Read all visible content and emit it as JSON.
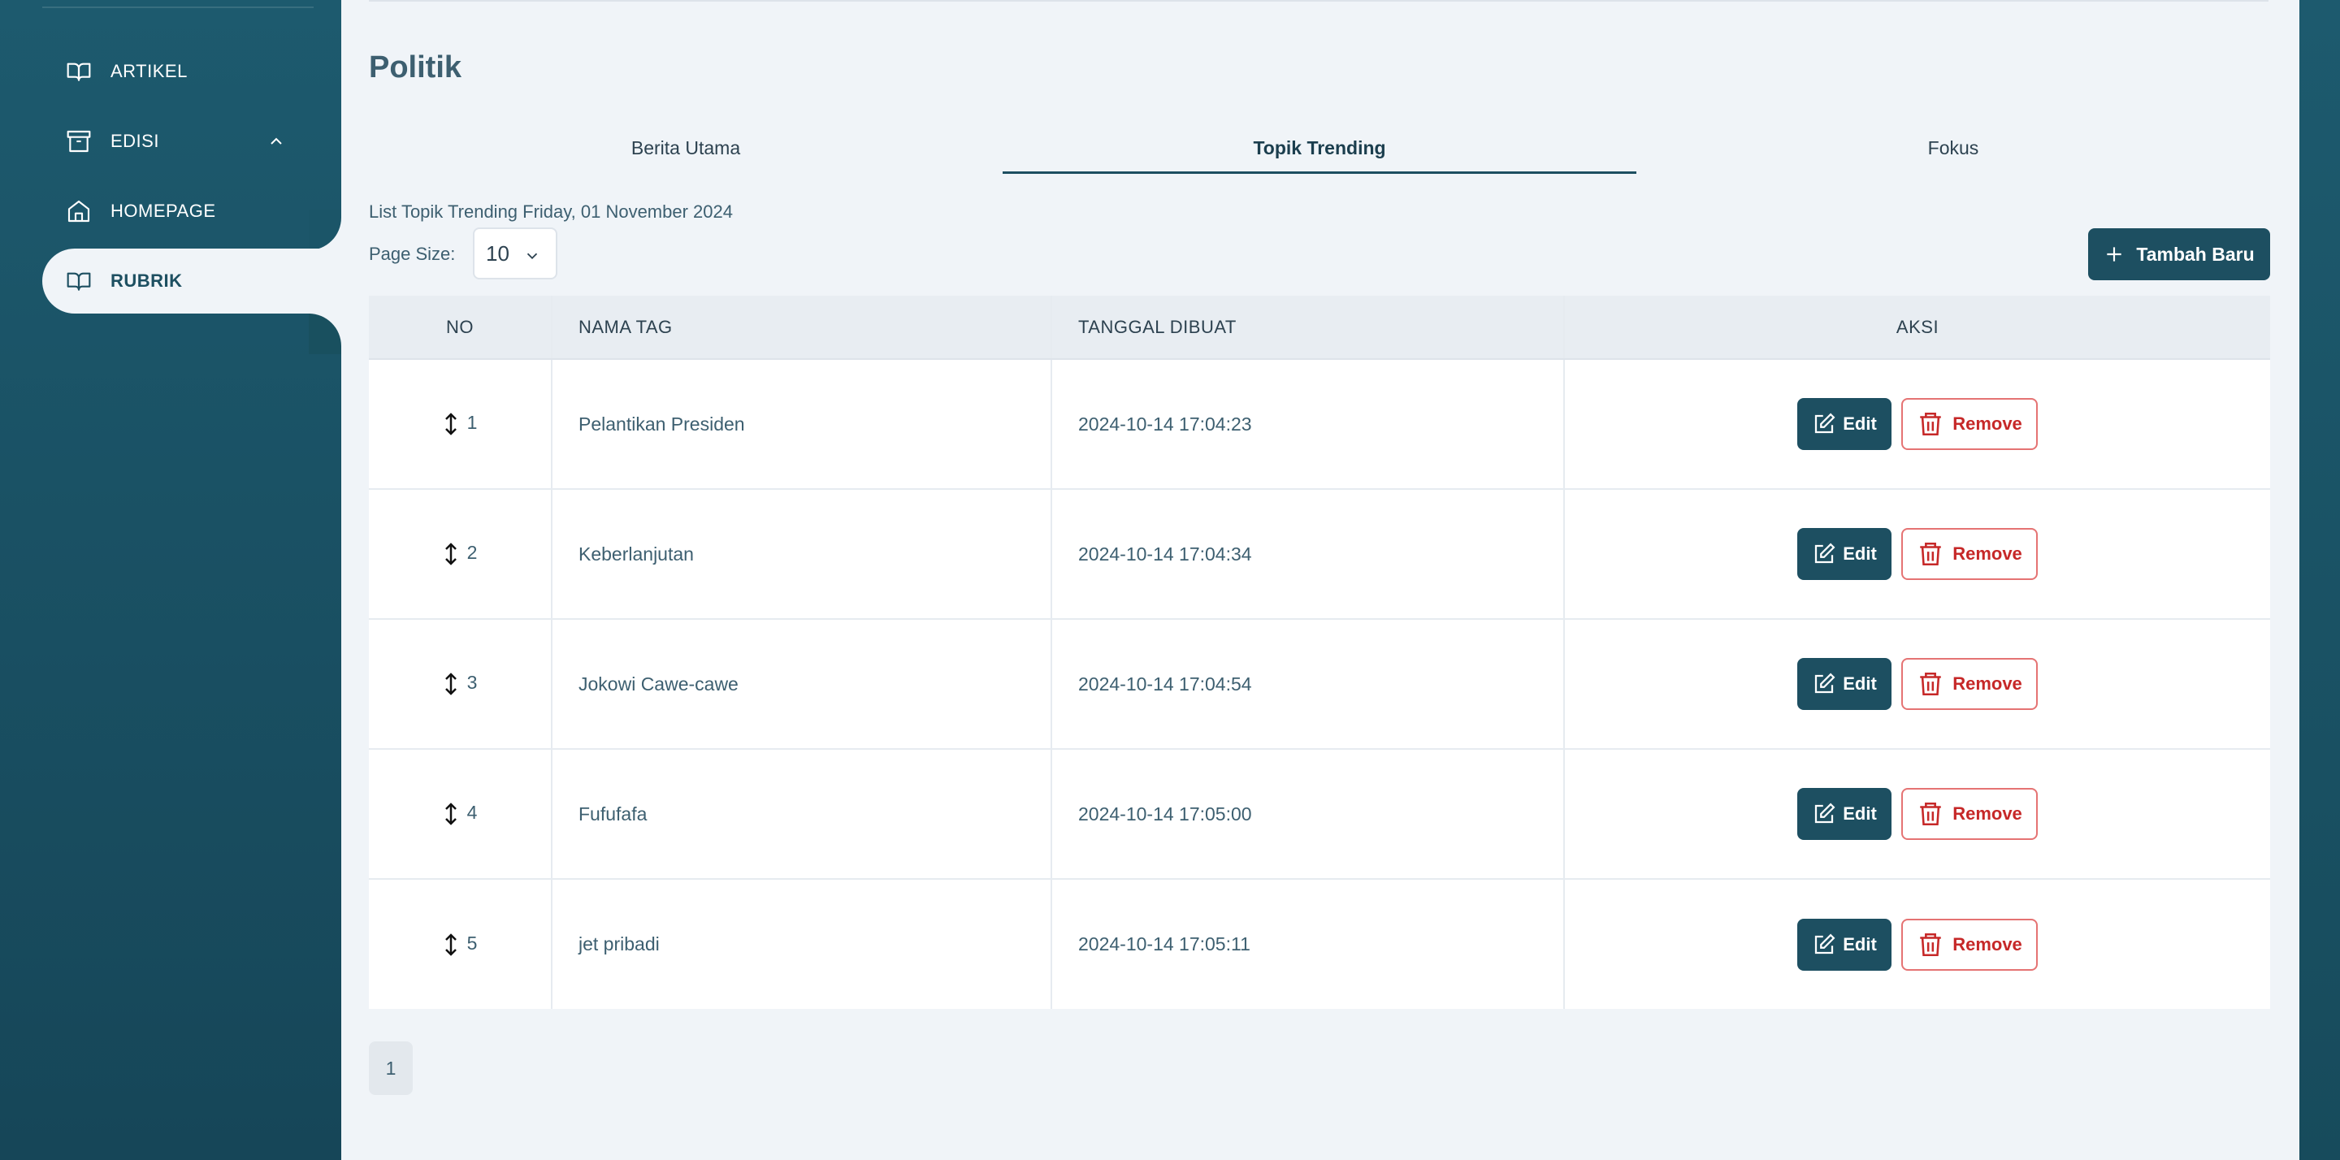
{
  "sidebar": {
    "items": [
      {
        "label": "ARTIKEL",
        "icon": "book-open-icon"
      },
      {
        "label": "EDISI",
        "icon": "archive-icon",
        "expanded": true
      },
      {
        "label": "HOMEPAGE",
        "icon": "home-icon"
      },
      {
        "label": "RUBRIK",
        "icon": "book-open-icon",
        "active": true
      }
    ]
  },
  "main": {
    "title": "Politik",
    "tabs": [
      "Berita Utama",
      "Topik Trending",
      "Fokus"
    ],
    "active_tab": "Topik Trending",
    "list_caption": "List Topik Trending Friday, 01 November 2024",
    "page_size_label": "Page Size:",
    "page_size_value": "10",
    "add_button": "Tambah Baru"
  },
  "table": {
    "headers": [
      "NO",
      "NAMA TAG",
      "TANGGAL DIBUAT",
      "AKSI"
    ],
    "rows": [
      {
        "no": "1",
        "name": "Pelantikan Presiden",
        "date": "2024-10-14 17:04:23"
      },
      {
        "no": "2",
        "name": "Keberlanjutan",
        "date": "2024-10-14 17:04:34"
      },
      {
        "no": "3",
        "name": "Jokowi Cawe-cawe",
        "date": "2024-10-14 17:04:54"
      },
      {
        "no": "4",
        "name": "Fufufafa",
        "date": "2024-10-14 17:05:00"
      },
      {
        "no": "5",
        "name": "jet pribadi",
        "date": "2024-10-14 17:05:11"
      }
    ],
    "edit_label": "Edit",
    "remove_label": "Remove"
  },
  "pagination": {
    "current": "1"
  },
  "colors": {
    "sidebar_bg": "#1d5a6e",
    "primary": "#1d4f61",
    "danger": "#c62828",
    "main_bg": "#f0f4f8"
  }
}
